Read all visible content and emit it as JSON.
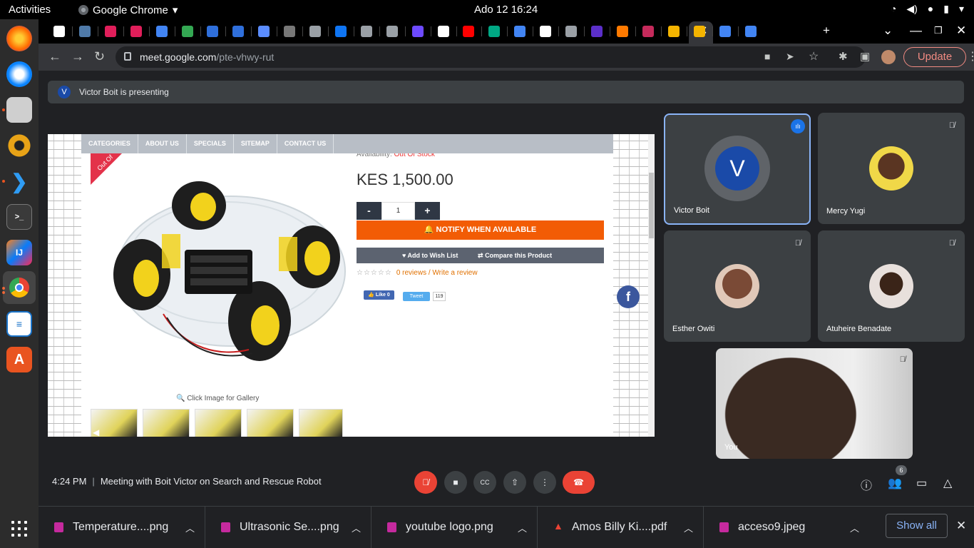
{
  "system": {
    "activities": "Activities",
    "app_menu": "Google Chrome",
    "clock": "Ado 12  16:24"
  },
  "dock": {
    "items": [
      "firefox-icon",
      "thunderbird-icon",
      "files-icon",
      "rhythmbox-icon",
      "vscode-icon",
      "terminal-icon",
      "intellij-icon",
      "chrome-icon",
      "libreoffice-writer-icon",
      "software-center-icon"
    ],
    "app_grid": "show-applications-icon"
  },
  "browser": {
    "tab_count_visible": 26,
    "tab_colors": [
      "#ffffff",
      "#4f7aa9",
      "#e01e5a",
      "#e01e5a",
      "#4285f4",
      "#34a853",
      "#2f6fdb",
      "#2f6fdb",
      "#5b8dff",
      "#777777",
      "#9aa0a6",
      "#0f75f3",
      "#9aa0a6",
      "#9aa0a6",
      "#6d4aff",
      "#ffffff",
      "#ff0000",
      "#00a884",
      "#4285f4",
      "#ffffff",
      "#9aa0a6",
      "#5b2fc9",
      "#ff7a00",
      "#c52a5b",
      "#f4b400",
      "#f4b400",
      "#4285f4",
      "#4285f4"
    ],
    "url_host": "meet.google.com",
    "url_path": "/pte-vhwy-rut",
    "update_label": "Update"
  },
  "meet": {
    "presenter_initial": "V",
    "presenting_text": "Victor Boit is presenting",
    "meeting_time": "4:24 PM",
    "meeting_title": "Meeting with Boit Victor on Search and Rescue Robot",
    "people_count": "6",
    "participants": [
      {
        "name": "Victor Boit",
        "initial": "V",
        "speaking": true
      },
      {
        "name": "Mercy Yugi",
        "muted": true
      },
      {
        "name": "Esther Owiti",
        "muted": true
      },
      {
        "name": "Atuheire Benadate",
        "muted": true
      }
    ],
    "self_name": "You"
  },
  "shared_page": {
    "nav": [
      "CATEGORIES",
      "ABOUT US",
      "SPECIALS",
      "SITEMAP",
      "CONTACT US"
    ],
    "availability_label": "Availability:",
    "availability_value": "Out Of Stock",
    "ribbon": "Out Of",
    "price": "KES 1,500.00",
    "qty_minus": "-",
    "qty_value": "1",
    "qty_plus": "+",
    "notify": "NOTIFY WHEN AVAILABLE",
    "wishlist": "Add to Wish List",
    "compare": "Compare this Product",
    "stars": "☆☆☆☆☆",
    "reviews_link": "0 reviews",
    "reviews_sep": " / ",
    "write_review": "Write a review",
    "fb_like": "Like 0",
    "tweet": "Tweet",
    "tweet_count": "119",
    "gallery_caption": "Click Image for Gallery",
    "facebook_letter": "f"
  },
  "downloads": [
    {
      "name": "Temperature....png",
      "type": "image"
    },
    {
      "name": "Ultrasonic Se....png",
      "type": "image"
    },
    {
      "name": "youtube logo.png",
      "type": "image"
    },
    {
      "name": "Amos Billy Ki....pdf",
      "type": "pdf"
    },
    {
      "name": "acceso9.jpeg",
      "type": "image"
    }
  ],
  "show_all": "Show all"
}
